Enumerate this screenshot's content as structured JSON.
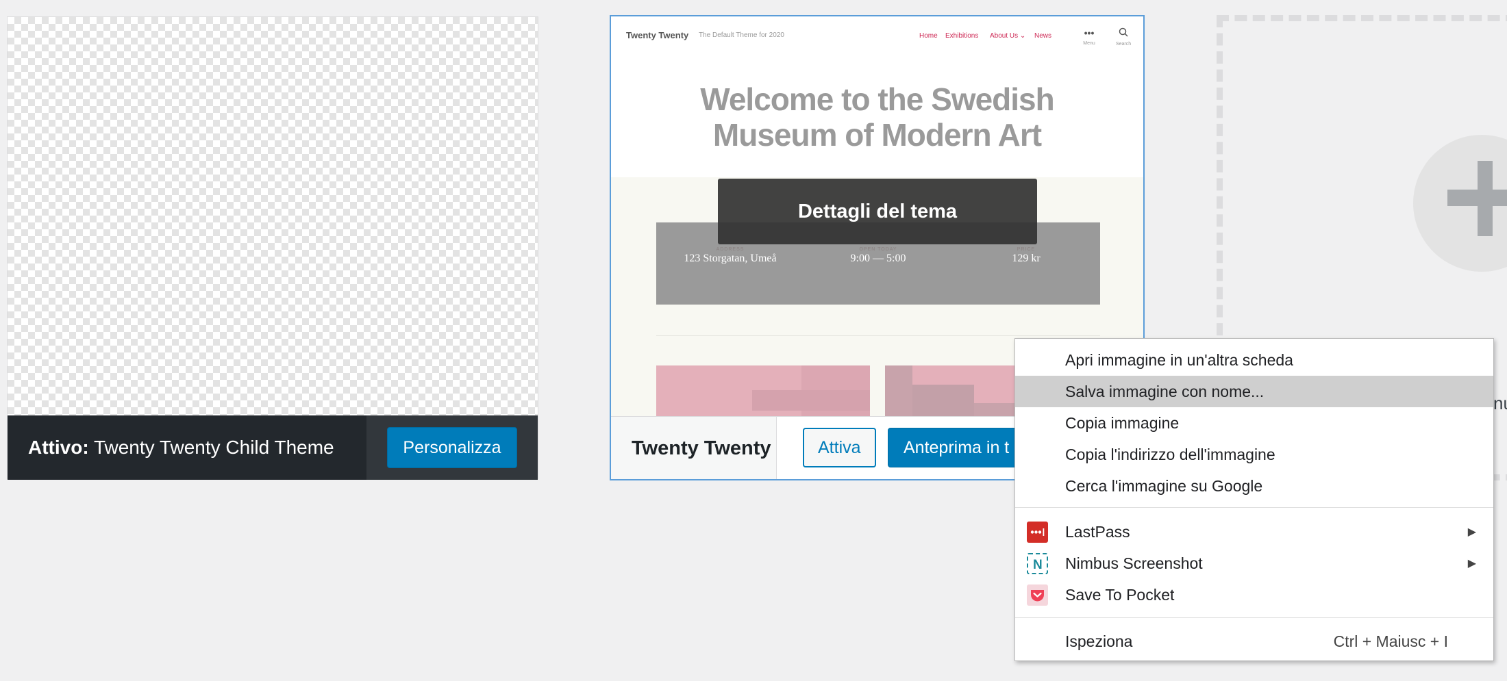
{
  "active_theme": {
    "status_label": "Attivo:",
    "theme_name": "Twenty Twenty Child Theme",
    "customize_label": "Personalizza"
  },
  "theme_card": {
    "name": "Twenty Twenty",
    "details_label": "Dettagli del tema",
    "activate_label": "Attiva",
    "preview_label": "Anteprima in t",
    "preview": {
      "site_title": "Twenty Twenty",
      "site_description": "The Default Theme for 2020",
      "nav": [
        "Home",
        "Exhibitions",
        "About Us",
        "News"
      ],
      "menu_label": "Menu",
      "search_label": "Search",
      "hero_line1": "Welcome to the Swedish",
      "hero_line2": "Museum of Modern Art",
      "info_captions": [
        "ADDRESS",
        "OPEN TODAY",
        "PRICE"
      ],
      "info_values": [
        "123 Storgatan, Umeå",
        "9:00 — 5:00",
        "129 kr"
      ]
    }
  },
  "add_new": {
    "partial_text": "nu"
  },
  "context_menu": {
    "items": [
      "Apri immagine in un'altra scheda",
      "Salva immagine con nome...",
      "Copia immagine",
      "Copia l'indirizzo dell'immagine",
      "Cerca l'immagine su Google"
    ],
    "extensions": [
      "LastPass",
      "Nimbus Screenshot",
      "Save To Pocket"
    ],
    "inspect_label": "Ispeziona",
    "inspect_shortcut": "Ctrl + Maiusc + I"
  },
  "colors": {
    "accent": "#007cba",
    "active_bar": "#23282d",
    "menu_highlight": "#cfcfcf",
    "lastpass": "#d32d27",
    "nimbus": "#1a8a9a",
    "pocket": "#ef4056"
  }
}
